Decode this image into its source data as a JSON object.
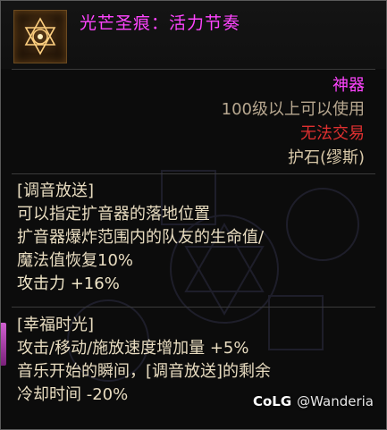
{
  "item": {
    "name": "光芒圣痕：活力节奏",
    "grade": "神器",
    "level_requirement": "100级以上可以使用",
    "trade_status": "无法交易",
    "slot_type": "护石(缪斯)",
    "icon": "crystal-star-icon"
  },
  "sections": [
    {
      "lines": [
        "[调音放送]",
        "可以指定扩音器的落地位置",
        "扩音器爆炸范围内的队友的生命值/",
        "魔法值恢复10%",
        "攻击力 +16%"
      ]
    },
    {
      "lines": [
        "[幸福时光]",
        "攻击/移动/施放速度增加量 +5%",
        "音乐开始的瞬间，[调音放送]的剩余",
        "冷却时间 -20%"
      ]
    }
  ],
  "watermark": {
    "logo": "CoLG",
    "user": "@Wanderia"
  },
  "colors": {
    "name": "#ff44ff",
    "grade": "#ff44ff",
    "trade": "#e03030",
    "body_text": "#e8dcc0"
  }
}
